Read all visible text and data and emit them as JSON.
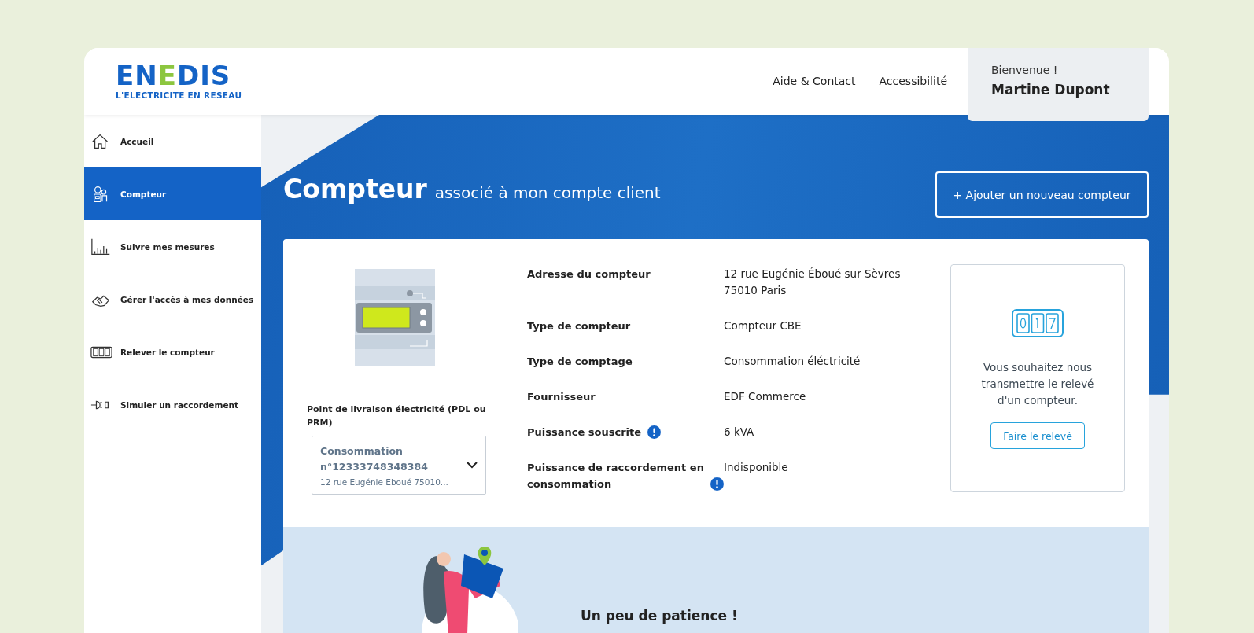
{
  "logo": {
    "name": "ENEDIS",
    "tagline": "L'ELECTRICITE EN RESEAU"
  },
  "header_links": [
    "Aide & Contact",
    "Accessibilité"
  ],
  "user": {
    "greeting": "Bienvenue !",
    "name": "Martine Dupont"
  },
  "sidebar": {
    "items": [
      {
        "label": "Accueil",
        "selected": false
      },
      {
        "label": "Compteur",
        "selected": true
      },
      {
        "label": "Suivre mes mesures",
        "selected": false
      },
      {
        "label": "Gérer l'accès à mes données",
        "selected": false
      },
      {
        "label": "Relever le compteur",
        "selected": false
      },
      {
        "label": "Simuler un raccordement",
        "selected": false
      }
    ]
  },
  "page": {
    "title": "Compteur",
    "subtitle": "associé à mon compte client",
    "add_button": "+ Ajouter un nouveau compteur"
  },
  "meter": {
    "delivery_point_label": "Point de livraison électricité (PDL ou PRM)",
    "select": {
      "title": "Consommation n°12333748348384",
      "address": "12 rue Eugénie Eboué 75010..."
    }
  },
  "details": [
    {
      "label": "Adresse du compteur",
      "info": false,
      "value": [
        "12 rue Eugénie Éboué sur Sèvres",
        "75010 Paris"
      ]
    },
    {
      "label": "Type de compteur",
      "info": false,
      "value": [
        "Compteur CBE"
      ]
    },
    {
      "label": "Type de comptage",
      "info": false,
      "value": [
        "Consommation éléctricité"
      ]
    },
    {
      "label": "Fournisseur",
      "info": false,
      "value": [
        "EDF Commerce"
      ]
    },
    {
      "label": "Puissance souscrite",
      "info": true,
      "value": [
        "6 kVA"
      ]
    },
    {
      "label": "Puissance de raccordement en consommation",
      "info": true,
      "value": [
        "Indisponible"
      ]
    }
  ],
  "reading_card": {
    "text": "Vous souhaitez nous transmettre le relevé d'un compteur.",
    "button": "Faire le relevé"
  },
  "notice": {
    "title": "Un peu de patience !"
  }
}
